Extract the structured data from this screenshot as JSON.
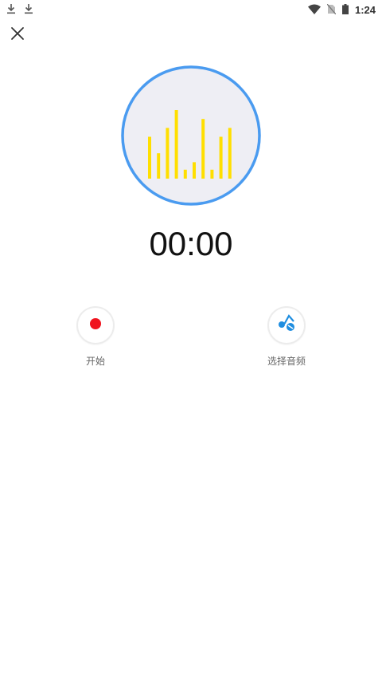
{
  "status_bar": {
    "time": "1:24",
    "icons": [
      "download-icon",
      "download-icon",
      "wifi-icon",
      "no-sim-icon",
      "battery-icon"
    ]
  },
  "toolbar": {
    "close_icon": "close-icon"
  },
  "visualizer": {
    "ring_color": "#4a9bf0",
    "fill_color": "#eeeef4",
    "bar_color": "#ffdf00",
    "levels": [
      0.61,
      0.37,
      0.74,
      1.0,
      0.13,
      0.24,
      0.87,
      0.13,
      0.61,
      0.74
    ]
  },
  "timer": {
    "value": "00:00"
  },
  "actions": {
    "start": {
      "label": "开始",
      "icon": "record-dot-icon",
      "color": "#f0141e"
    },
    "choose_audio": {
      "label": "选择音频",
      "icon": "music-note-icon",
      "color": "#1f8ee0"
    }
  }
}
